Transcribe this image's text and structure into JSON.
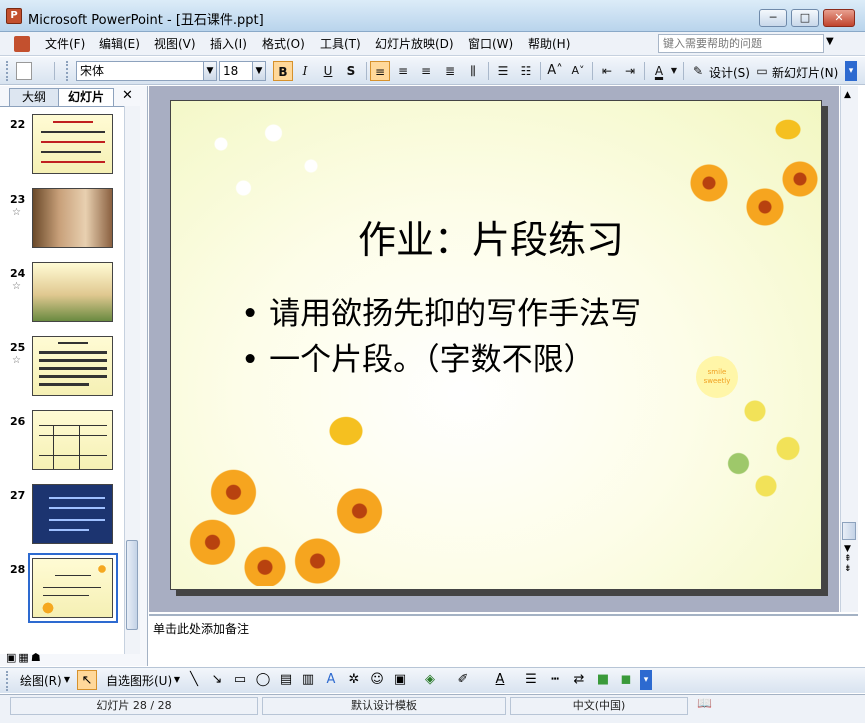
{
  "window": {
    "title": "Microsoft PowerPoint - [丑石课件.ppt]",
    "app_icon": "P"
  },
  "window_controls": {
    "minimize": "─",
    "maximize": "□",
    "close": "✕"
  },
  "menu": [
    {
      "label": "文件(F)"
    },
    {
      "label": "编辑(E)"
    },
    {
      "label": "视图(V)"
    },
    {
      "label": "插入(I)"
    },
    {
      "label": "格式(O)"
    },
    {
      "label": "工具(T)"
    },
    {
      "label": "幻灯片放映(D)"
    },
    {
      "label": "窗口(W)"
    },
    {
      "label": "帮助(H)"
    }
  ],
  "help": {
    "placeholder": "键入需要帮助的问题"
  },
  "toolbar": {
    "font_name": "宋体",
    "font_size": "18",
    "bold": "B",
    "italic": "I",
    "underline": "U",
    "shadow": "S",
    "design_label": "设计(S)",
    "new_slide_label": "新幻灯片(N)"
  },
  "panel": {
    "tab_outline": "大纲",
    "tab_slides": "幻灯片",
    "close": "✕"
  },
  "thumbnails": [
    {
      "num": "22",
      "star": ""
    },
    {
      "num": "23",
      "star": "☆"
    },
    {
      "num": "24",
      "star": "☆"
    },
    {
      "num": "25",
      "star": "☆"
    },
    {
      "num": "26",
      "star": ""
    },
    {
      "num": "27",
      "star": ""
    },
    {
      "num": "28",
      "star": ""
    }
  ],
  "slide": {
    "title": "作业：片段练习",
    "bullets": [
      "请用欲扬先抑的写作手法写",
      "一个片段。（字数不限）"
    ],
    "badge": "smile sweetly"
  },
  "notes": {
    "placeholder": "单击此处添加备注"
  },
  "drawing": {
    "draw_label": "绘图(R)",
    "autoshape_label": "自选图形(U)"
  },
  "status": {
    "slide_pos": "幻灯片 28 / 28",
    "template": "默认设计模板",
    "language": "中文(中国)"
  },
  "colors": {
    "accent": "#2d6ad0",
    "selected_button": "#ffd89a"
  }
}
